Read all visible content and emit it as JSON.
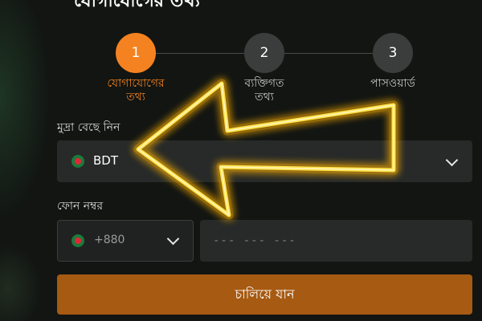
{
  "modal": {
    "title": "যোগাযোগের তথ্য"
  },
  "stepper": {
    "steps": [
      {
        "number": "1",
        "label_line1": "যোগাযোগের",
        "label_line2": "তথ্য",
        "active": true
      },
      {
        "number": "2",
        "label_line1": "ব্যক্তিগত",
        "label_line2": "তথ্য",
        "active": false
      },
      {
        "number": "3",
        "label_line1": "পাসওয়ার্ড",
        "label_line2": "",
        "active": false
      }
    ]
  },
  "currency": {
    "label": "মুদ্রা বেছে নিন",
    "value": "BDT",
    "flag_icon": "bangladesh-flag-icon"
  },
  "phone": {
    "label": "ফোন নম্বর",
    "country_code": "+880",
    "placeholder": "--- --- ---"
  },
  "continue_button": {
    "label": "চালিয়ে যান"
  },
  "colors": {
    "accent": "#f58220",
    "button": "#a65a12",
    "arrow_glow": "#ffd21a"
  }
}
